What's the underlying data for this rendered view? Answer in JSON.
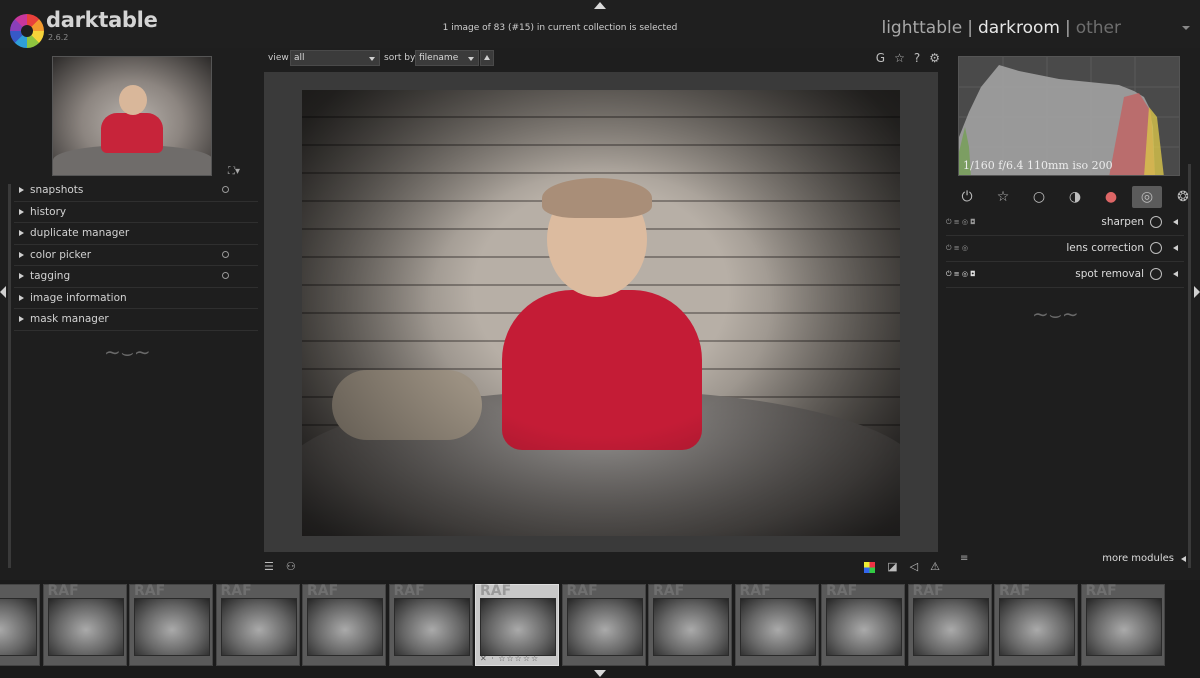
{
  "app": {
    "name": "darktable",
    "version": "2.6.2"
  },
  "header": {
    "status": "1 image of 83 (#15) in current collection is selected",
    "views": {
      "lighttable": "lighttable",
      "darkroom": "darkroom",
      "other": "other",
      "separator": "|"
    }
  },
  "left": {
    "modules": [
      {
        "label": "snapshots",
        "has_reset": true
      },
      {
        "label": "history",
        "has_reset": false
      },
      {
        "label": "duplicate manager",
        "has_reset": false
      },
      {
        "label": "color picker",
        "has_reset": true
      },
      {
        "label": "tagging",
        "has_reset": true
      },
      {
        "label": "image information",
        "has_reset": false
      },
      {
        "label": "mask manager",
        "has_reset": false
      }
    ]
  },
  "center": {
    "view_label": "view",
    "view_value": "all",
    "sortby_label": "sort by",
    "sortby_value": "filename",
    "icons": [
      "G",
      "☆",
      "?",
      "⚙"
    ]
  },
  "right": {
    "exif": "1/160 f/6.4 110mm iso 200",
    "groups": [
      "power-icon",
      "star-icon",
      "circle-icon",
      "tone-icon",
      "color-icon",
      "correct-icon",
      "effect-icon"
    ],
    "active_group": 5,
    "modules": [
      {
        "name": "sharpen"
      },
      {
        "name": "lens correction"
      },
      {
        "name": "spot removal"
      }
    ],
    "more_modules": "more modules"
  },
  "filmstrip": {
    "badge": "RAF",
    "selected_index": 6,
    "cell_count": 14
  }
}
